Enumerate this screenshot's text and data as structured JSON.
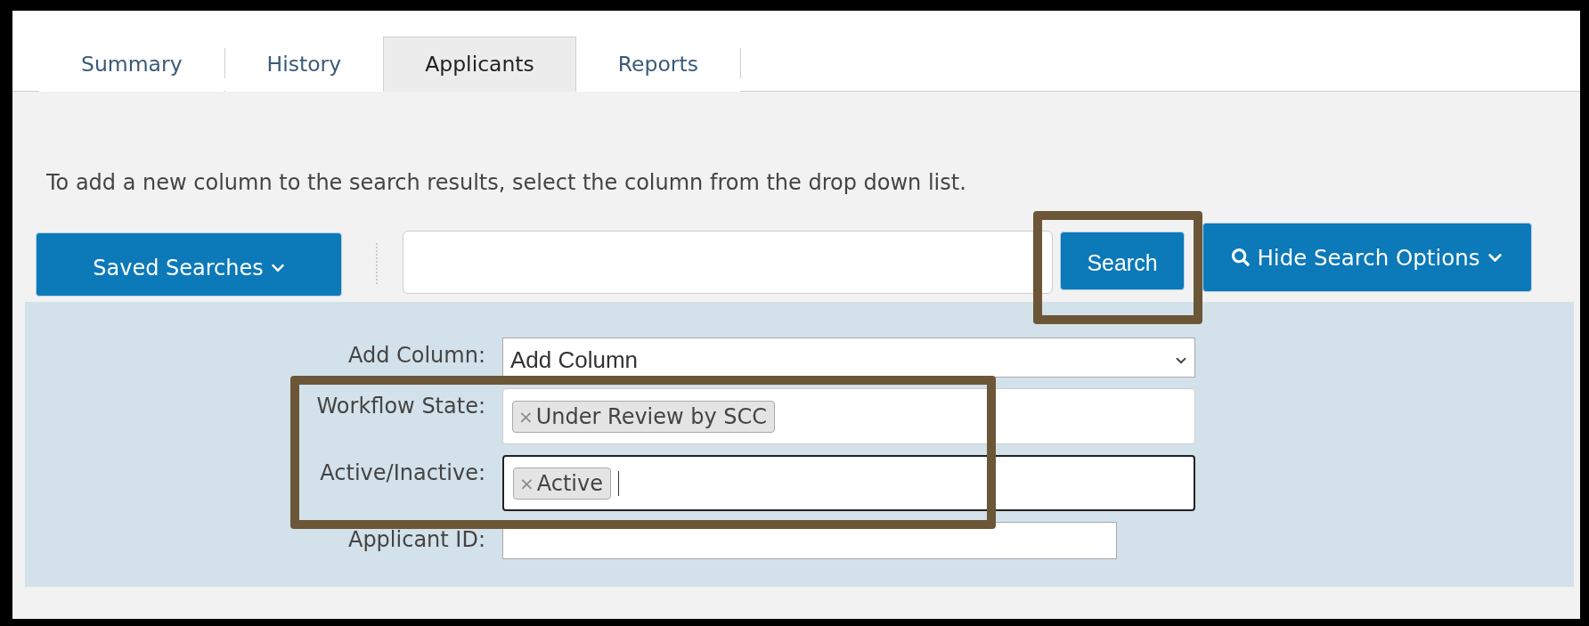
{
  "tabs": [
    {
      "label": "Summary",
      "selected": false
    },
    {
      "label": "History",
      "selected": false
    },
    {
      "label": "Applicants",
      "selected": true
    },
    {
      "label": "Reports",
      "selected": false
    }
  ],
  "instruction": "To add a new column to the search results, select the column from the drop down list.",
  "toolbar": {
    "saved_searches": "Saved Searches",
    "search_button": "Search",
    "toggle_options": "Hide Search Options"
  },
  "search_options": [
    {
      "kind": "select",
      "label": "Add Column:",
      "value": "Add Column",
      "focused": false
    },
    {
      "kind": "tags",
      "label": "Workflow State:",
      "tags": [
        {
          "remove": "×",
          "label": "Under Review by SCC"
        }
      ],
      "focused": false
    },
    {
      "kind": "tags",
      "label": "Active/Inactive:",
      "tags": [
        {
          "remove": "×",
          "label": "Active"
        }
      ],
      "focused": true
    },
    {
      "kind": "text",
      "label": "Applicant ID:",
      "focused": false
    }
  ]
}
